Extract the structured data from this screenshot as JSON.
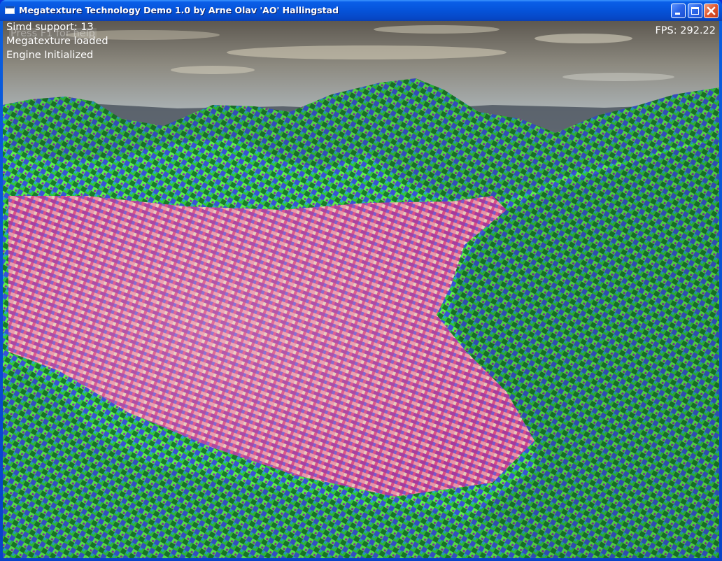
{
  "window": {
    "title": "Megatexture Technology Demo 1.0 by Arne Olav 'AO' Hallingstad",
    "icon": "app-window-icon",
    "controls": {
      "minimize_icon": "minimize-icon",
      "maximize_icon": "maximize-icon",
      "close_icon": "close-icon"
    }
  },
  "hud": {
    "help_hint": "Press F1 for help",
    "simd_support": "Simd support: 13",
    "megatexture_status": "Megatexture loaded",
    "engine_status": "Engine Initialized",
    "fps": "FPS: 292.22"
  },
  "colors": {
    "titlebar_blue": "#0553d9",
    "close_red": "#e0562e",
    "sky_top": "#5f5a52",
    "sky_bottom": "#b9c3ca",
    "terrain_green": "#2fd73a",
    "terrain_blue": "#3a4fd8",
    "valley_pink": "#d9487e"
  }
}
